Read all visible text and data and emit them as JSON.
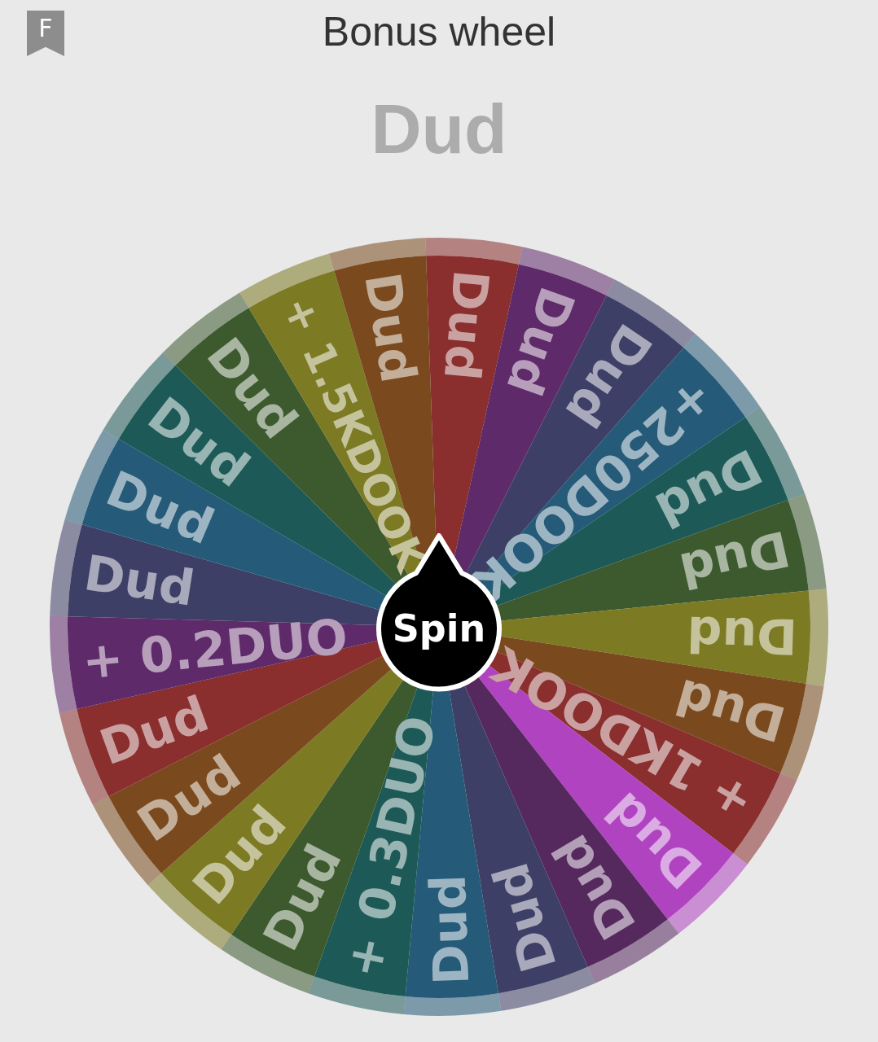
{
  "bookmark": {
    "letter": "F"
  },
  "title": "Bonus wheel",
  "result": "Dud",
  "wheel": {
    "spin_button": "Spin",
    "segments": [
      {
        "label": "Dud",
        "color": "#8a2e2e"
      },
      {
        "label": "Dud",
        "color": "#5e2a6a"
      },
      {
        "label": "Dud",
        "color": "#3e3f66"
      },
      {
        "label": "+250DOOK",
        "color": "#255a78"
      },
      {
        "label": "Dud",
        "color": "#1d5a57"
      },
      {
        "label": "Dud",
        "color": "#3d5a2f"
      },
      {
        "label": "Dud",
        "color": "#7d7a24"
      },
      {
        "label": "Dud",
        "color": "#7a4a1e"
      },
      {
        "label": "+ 1KDOOK",
        "color": "#8a2e2e"
      },
      {
        "label": "Dud",
        "color": "#b044c0"
      },
      {
        "label": "Dud",
        "color": "#55285e"
      },
      {
        "label": "Dud",
        "color": "#3e3f66"
      },
      {
        "label": "Dud",
        "color": "#255a78"
      },
      {
        "label": "+ 0.3DUO",
        "color": "#1d5a57"
      },
      {
        "label": "Dud",
        "color": "#3d5a2f"
      },
      {
        "label": "Dud",
        "color": "#7d7a24"
      },
      {
        "label": "Dud",
        "color": "#7a4a1e"
      },
      {
        "label": "Dud",
        "color": "#8a2e2e"
      },
      {
        "label": "+ 0.2DUO",
        "color": "#5e2a6a"
      },
      {
        "label": "Dud",
        "color": "#3e3f66"
      },
      {
        "label": "Dud",
        "color": "#255a78"
      },
      {
        "label": "Dud",
        "color": "#1d5a57"
      },
      {
        "label": "Dud",
        "color": "#3d5a2f"
      },
      {
        "label": "+ 1.5KDOOK",
        "color": "#7d7a24"
      },
      {
        "label": "Dud",
        "color": "#7a4a1e"
      }
    ]
  }
}
